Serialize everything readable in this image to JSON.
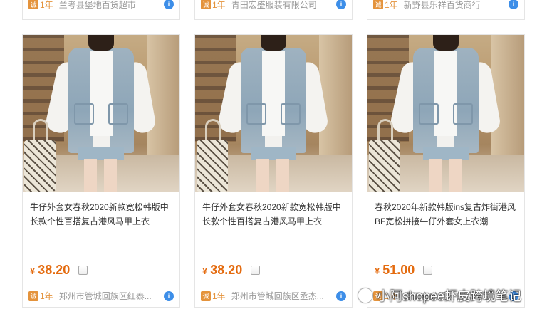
{
  "top_cards": [
    {
      "badge": "诚",
      "years": "1年",
      "shop": "兰考县堡地百货超市"
    },
    {
      "badge": "诚",
      "years": "1年",
      "shop": "青田宏盛服装有限公司"
    },
    {
      "badge": "诚",
      "years": "1年",
      "shop": "新野县乐祥百货商行"
    }
  ],
  "products": [
    {
      "title_line1": "牛仔外套女春秋2020新款宽松韩版中",
      "title_line2": "长款个性百搭复古港风马甲上衣",
      "currency": "¥",
      "price": "38.20",
      "badge": "诚",
      "years": "1年",
      "shop": "郑州市管城回族区红泰..."
    },
    {
      "title_line1": "牛仔外套女春秋2020新款宽松韩版中",
      "title_line2": "长款个性百搭复古港风马甲上衣",
      "currency": "¥",
      "price": "38.20",
      "badge": "诚",
      "years": "1年",
      "shop": "郑州市管城回族区丞杰..."
    },
    {
      "title_line1": "春秋2020年新款韩版ins复古炸街港风",
      "title_line2": "BF宽松拼接牛仔外套女上衣潮",
      "currency": "¥",
      "price": "51.00",
      "badge": "诚",
      "years": "1年",
      "shop": "青田宏盛服装有限公司"
    }
  ],
  "watermark": {
    "text": "小阿shopee虾皮跨境笔记"
  },
  "colors": {
    "price": "#e46b0f",
    "badge": "#e4933c",
    "info_icon": "#3d8ee8"
  }
}
